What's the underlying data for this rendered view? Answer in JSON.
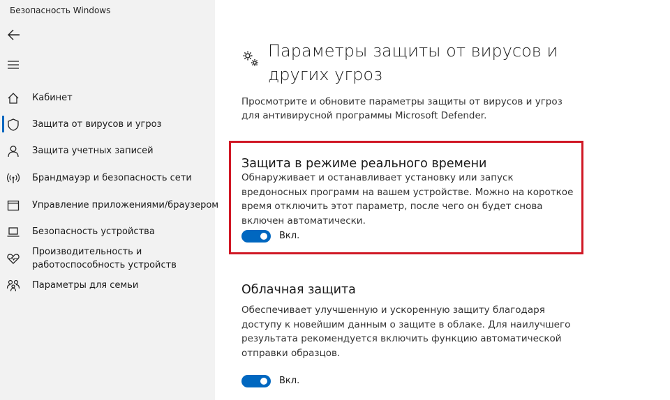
{
  "window": {
    "title": "Безопасность Windows"
  },
  "sidebar": {
    "items": [
      {
        "label": "Кабинет",
        "icon": "home-icon"
      },
      {
        "label": "Защита от вирусов и угроз",
        "icon": "shield-icon",
        "active": true
      },
      {
        "label": "Защита учетных записей",
        "icon": "person-icon"
      },
      {
        "label": "Брандмауэр и безопасность сети",
        "icon": "network-icon"
      },
      {
        "label": "Управление приложениями/браузером",
        "icon": "app-browser-icon"
      },
      {
        "label": "Безопасность устройства",
        "icon": "laptop-icon"
      },
      {
        "label": "Производительность и работоспособность устройств",
        "label_line1": "Производительность и",
        "label_line2": "работоспособность устройств",
        "icon": "heart-icon"
      },
      {
        "label": "Параметры для семьи",
        "icon": "family-icon"
      }
    ]
  },
  "main": {
    "title": "Параметры защиты от вирусов и других угроз",
    "title_line1": "Параметры защиты от вирусов и",
    "title_line2": "других угроз",
    "description": "Просмотрите и обновите параметры защиты от вирусов и угроз для антивирусной программы Microsoft Defender.",
    "sections": [
      {
        "title": "Защита в режиме реального времени",
        "description": "Обнаруживает и останавливает установку или запуск вредоносных программ на вашем устройстве. Можно на короткое время отключить этот параметр, после чего он будет снова включен автоматически.",
        "toggle_label": "Вкл.",
        "toggle_on": true,
        "highlighted": true
      },
      {
        "title": "Облачная защита",
        "description": "Обеспечивает улучшенную и ускоренную защиту благодаря доступу к новейшим данным о защите в облаке. Для наилучшего результата рекомендуется включить функцию автоматической отправки образцов.",
        "toggle_label": "Вкл.",
        "toggle_on": true
      }
    ]
  },
  "colors": {
    "accent": "#0067c0",
    "highlight": "#d01825",
    "sidebar_bg": "#f2f2f2"
  }
}
